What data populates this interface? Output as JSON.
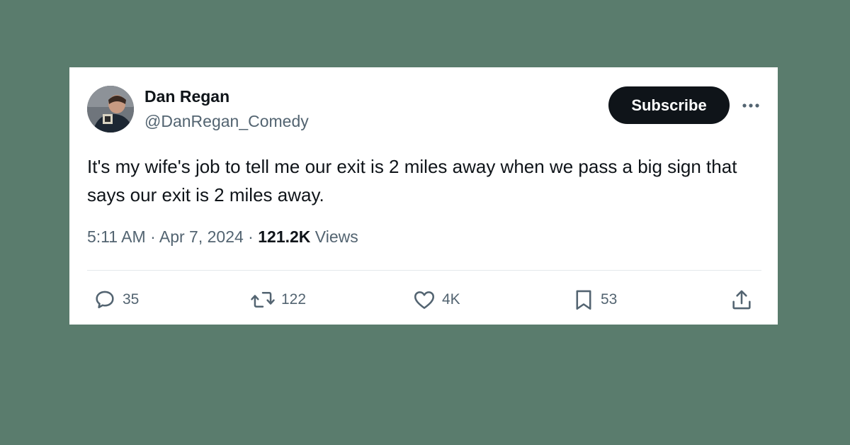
{
  "tweet": {
    "author": {
      "display_name": "Dan Regan",
      "handle": "@DanRegan_Comedy"
    },
    "subscribe_label": "Subscribe",
    "text": "It's my wife's job to tell me our exit is 2 miles away when we pass a big sign that says our exit is 2 miles away.",
    "time": "5:11 AM",
    "separator": " · ",
    "date": "Apr 7, 2024",
    "views_count": "121.2K",
    "views_label": " Views",
    "actions": {
      "replies": "35",
      "reposts": "122",
      "likes": "4K",
      "bookmarks": "53"
    }
  },
  "icons": {
    "reply": "speech-bubble-icon",
    "repost": "repost-arrows-icon",
    "like": "heart-icon",
    "bookmark": "bookmark-icon",
    "share": "share-upload-icon",
    "more": "more-horizontal-icon"
  },
  "colors": {
    "background": "#5a7c6d",
    "card": "#ffffff",
    "text_primary": "#0f1419",
    "text_secondary": "#536471",
    "button": "#0f1419"
  }
}
